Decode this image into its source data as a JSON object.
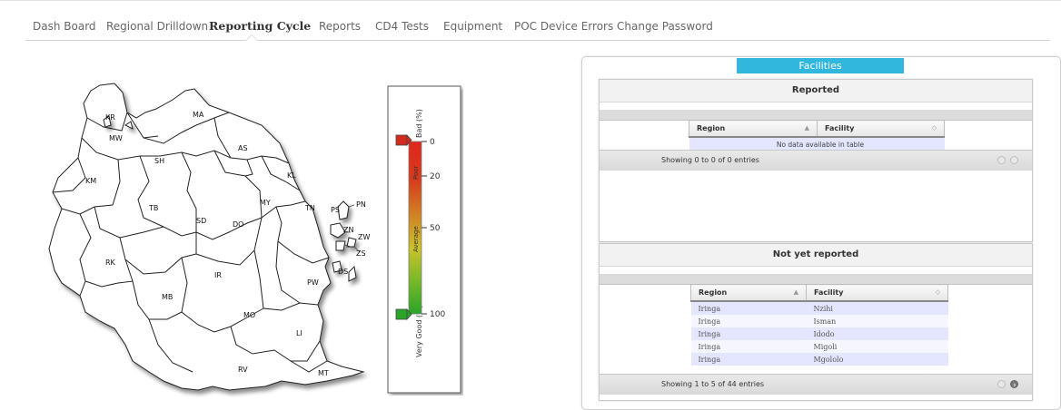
{
  "nav": {
    "items": [
      {
        "label": "Dash Board"
      },
      {
        "label": "Regional Drilldown"
      },
      {
        "label": "Reporting Cycle"
      },
      {
        "label": "Reports"
      },
      {
        "label": "CD4 Tests"
      },
      {
        "label": "Equipment"
      },
      {
        "label": "POC Device Errors"
      },
      {
        "label": "Change Password"
      }
    ],
    "active": "Reporting Cycle"
  },
  "map": {
    "regions": [
      "KR",
      "MW",
      "MA",
      "AS",
      "SH",
      "KM",
      "KL",
      "TB",
      "SD",
      "DO",
      "MY",
      "TN",
      "PS",
      "PN",
      "ZN",
      "ZW",
      "ZS",
      "DS",
      "RK",
      "MB",
      "IR",
      "PW",
      "MO",
      "LI",
      "RV",
      "MT"
    ]
  },
  "legend": {
    "axis_label_top": "Bad (%)",
    "axis_label_bottom": "Very Good (%)",
    "band_poor": "Poor",
    "band_average": "Average",
    "ticks": [
      "0",
      "20",
      "50",
      "100"
    ],
    "colors": {
      "bad": "#e0261d",
      "average": "#d4c12a",
      "good": "#2aa52a"
    }
  },
  "facilities": {
    "tab": "Facilities",
    "reported": {
      "title": "Reported",
      "columns": [
        "Region",
        "Facility"
      ],
      "empty": "No data available in table",
      "info": "Showing 0 to 0 of 0 entries"
    },
    "not_reported": {
      "title": "Not yet reported",
      "columns": [
        "Region",
        "Facility"
      ],
      "rows": [
        [
          "Iringa",
          "Nzihi"
        ],
        [
          "Iringa",
          "Isman"
        ],
        [
          "Iringa",
          "Idodo"
        ],
        [
          "Iringa",
          "Migoli"
        ],
        [
          "Iringa",
          "Mgololo"
        ]
      ],
      "info": "Showing 1 to 5 of 44 entries"
    }
  },
  "colors": {
    "accent_tab": "#31b6de",
    "row_odd": "#e4e5ff",
    "row_even": "#f6f6ff"
  }
}
